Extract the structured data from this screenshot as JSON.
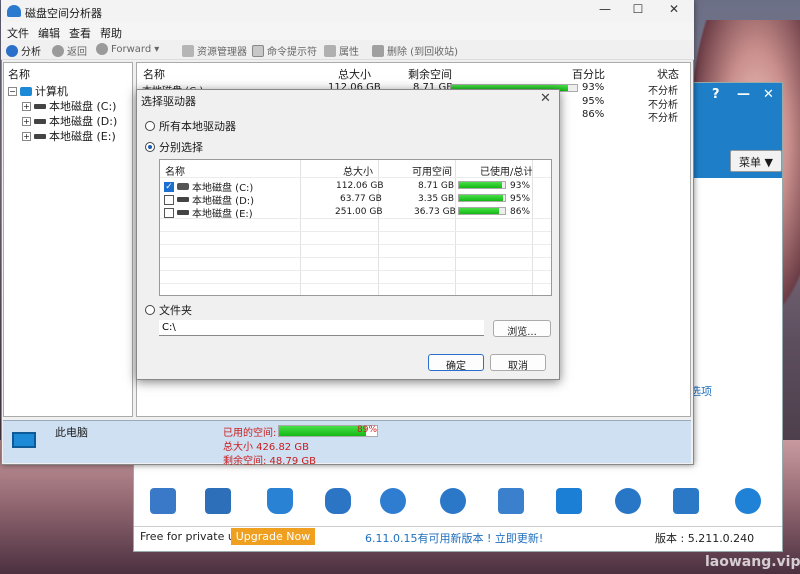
{
  "main_window": {
    "title": "磁盘空间分析器",
    "controls": {
      "minimize": "—",
      "maximize": "☐",
      "close": "✕"
    },
    "menu": [
      "文件",
      "编辑",
      "查看",
      "帮助"
    ],
    "toolbar": {
      "analyze": "分析",
      "back": "返回",
      "forward": "Forward",
      "explorer": "资源管理器",
      "cmd": "命令提示符",
      "properties": "属性",
      "delete": "删除 (到回收站)"
    }
  },
  "tree": {
    "header": "名称",
    "root": "计算机",
    "drives": [
      "本地磁盘 (C:)",
      "本地磁盘 (D:)",
      "本地磁盘 (E:)"
    ]
  },
  "list": {
    "columns": [
      "名称",
      "总大小",
      "剩余空间",
      "百分比",
      "状态"
    ],
    "rows": [
      {
        "name": "本地磁盘 (C:)",
        "total": "112.06 GB",
        "free": "8.71 GB",
        "percent": "93%",
        "percent_value": 93,
        "status": "不分析"
      },
      {
        "name": "",
        "total": "",
        "free": "",
        "percent": "95%",
        "percent_value": 95,
        "status": "不分析"
      },
      {
        "name": "",
        "total": "",
        "free": "",
        "percent": "86%",
        "percent_value": 86,
        "status": "不分析"
      }
    ]
  },
  "summary": {
    "name": "此电脑",
    "used_label": "已用的空间:",
    "used_percent": "89%",
    "used_value": 89,
    "total": "总大小 426.82 GB",
    "free": "剩余空间: 48.79 GB"
  },
  "dialog": {
    "title": "选择驱动器",
    "close": "✕",
    "option_all": "所有本地驱动器",
    "option_select": "分别选择",
    "option_folder": "文件夹",
    "columns": [
      "名称",
      "总大小",
      "可用空间",
      "已使用/总计"
    ],
    "drives": [
      {
        "name": "本地磁盘 (C:)",
        "total": "112.06 GB",
        "free": "8.71 GB",
        "percent": "93%",
        "percent_value": 93,
        "checked": true
      },
      {
        "name": "本地磁盘 (D:)",
        "total": "63.77 GB",
        "free": "3.35 GB",
        "percent": "95%",
        "percent_value": 95,
        "checked": false
      },
      {
        "name": "本地磁盘 (E:)",
        "total": "251.00 GB",
        "free": "36.73 GB",
        "percent": "86%",
        "percent_value": 86,
        "checked": false
      }
    ],
    "folder_path": "C:\\",
    "browse": "浏览...",
    "ok": "确定",
    "cancel": "取消"
  },
  "background_app": {
    "menu_button": "菜单 ▼",
    "options_link": "选项",
    "free_text": "Free for private use",
    "upgrade": "Upgrade Now",
    "new_version": "6.11.0.15有可用新版本 ! 立即更新!",
    "version": "版本 :  5.211.0.240",
    "ctrl": [
      "?",
      "—",
      "✕"
    ]
  },
  "watermark": "laowang.vip",
  "colors": {
    "accent": "#1e7fc8",
    "bar_green": "#14b814",
    "red_text": "#c81d1d"
  }
}
